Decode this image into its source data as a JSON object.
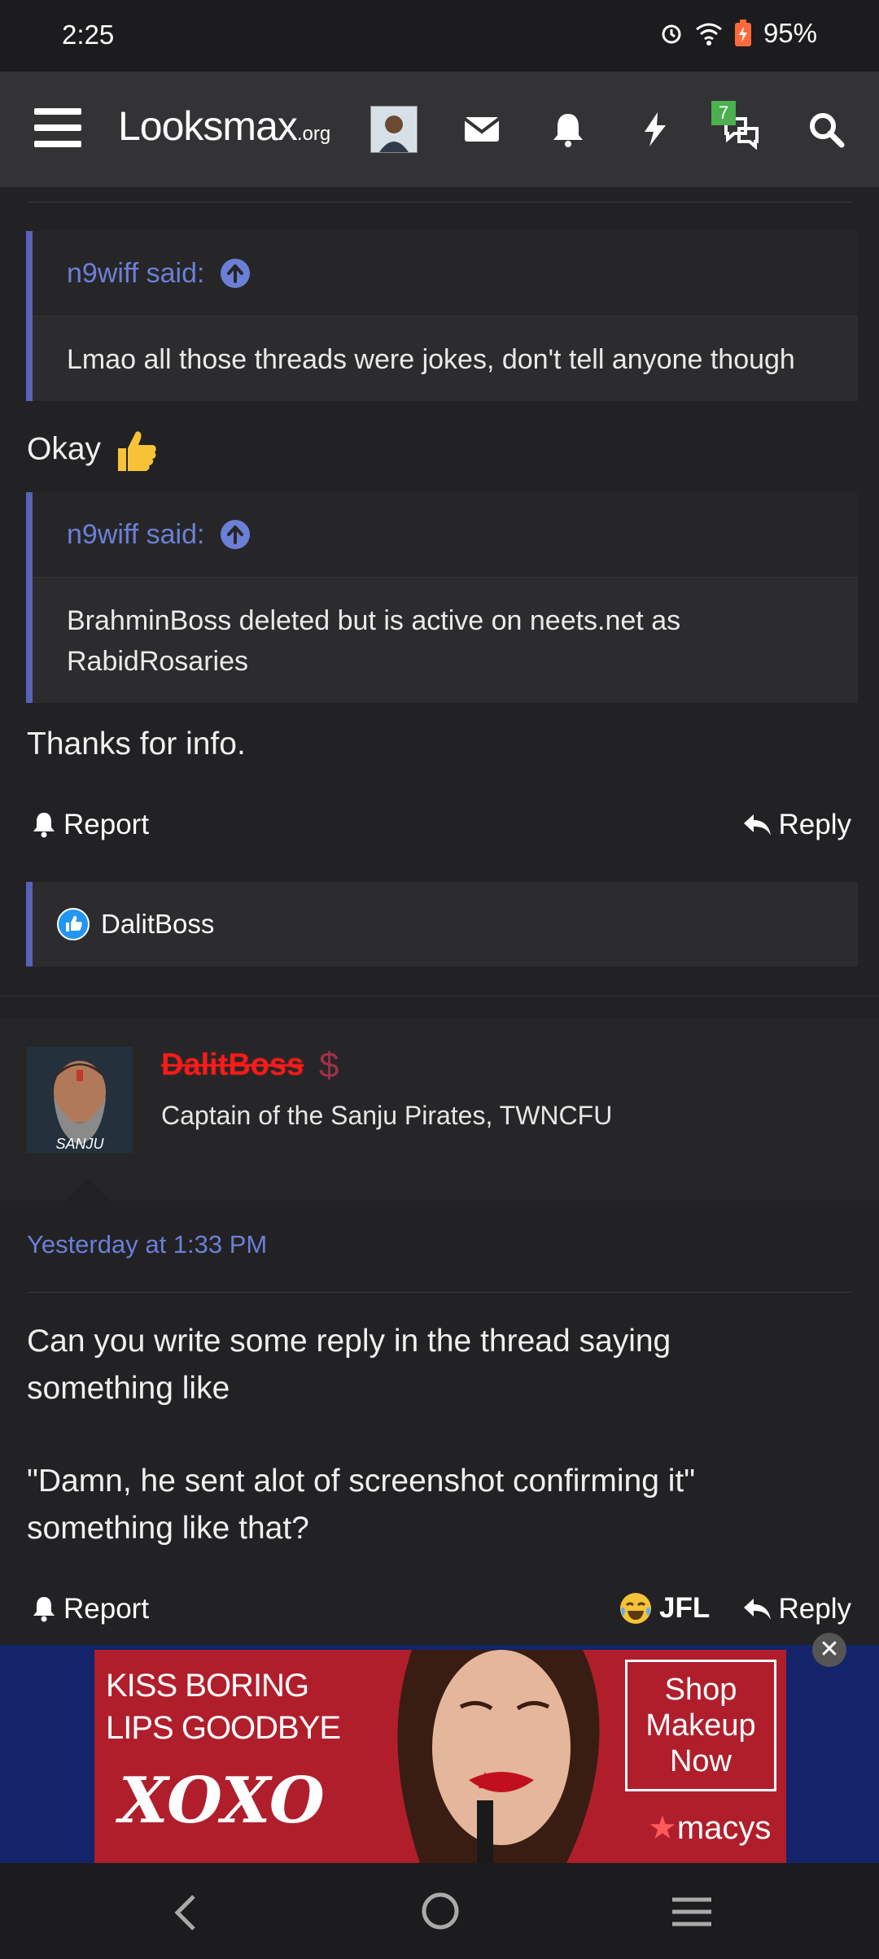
{
  "status_bar": {
    "time": "2:25",
    "battery": "95%"
  },
  "header": {
    "logo_main": "Looksmax",
    "logo_suffix": ".org",
    "chat_badge": "7"
  },
  "quote1": {
    "author": "n9wiff said:",
    "text": "Lmao all those threads were jokes, don't tell anyone though"
  },
  "reply1": {
    "text": "Okay"
  },
  "quote2": {
    "author": "n9wiff said:",
    "text": "BrahminBoss deleted but is active on neets.net as RabidRosaries"
  },
  "reply2": {
    "text": "Thanks for info."
  },
  "post1_actions": {
    "report": "Report",
    "reply": "Reply"
  },
  "reactions": {
    "user": "DalitBoss"
  },
  "post2": {
    "username": "DalitBoss",
    "user_title": "Captain of the Sanju Pirates, TWNCFU",
    "avatar_caption": "SANJU",
    "date": "Yesterday at 1:33 PM",
    "line1": "Can you write some reply in the thread saying",
    "line2": "something like",
    "line3": "\"Damn, he sent alot of screenshot confirming it\"",
    "line4": "something like that?",
    "report": "Report",
    "reaction": "JFL",
    "reply": "Reply"
  },
  "ad": {
    "line1": "KISS BORING",
    "line2": "LIPS GOODBYE",
    "brand_text": "XOXO",
    "cta": "Shop Makeup Now",
    "store": "macys"
  },
  "colors": {
    "accent": "#6c7fd6",
    "quote_border": "#5663b8",
    "username": "#ff1a1a",
    "badge": "#4caf50"
  }
}
